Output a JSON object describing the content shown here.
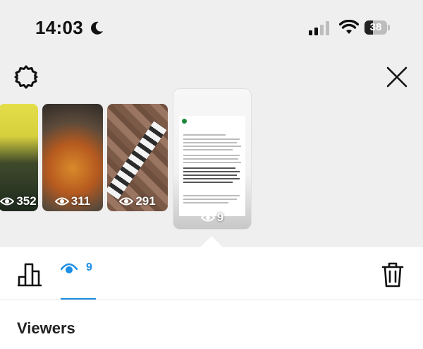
{
  "status_bar": {
    "time": "14:03",
    "battery_level": "38",
    "battery_fraction": 0.38,
    "icons": [
      "moon-icon",
      "signal-icon",
      "wifi-icon",
      "battery-icon"
    ]
  },
  "header": {
    "icons": [
      "settings-icon",
      "close-icon"
    ]
  },
  "stories": [
    {
      "views": "352"
    },
    {
      "views": "311"
    },
    {
      "views": "291"
    },
    {
      "views": "9",
      "selected": true
    }
  ],
  "toolbar": {
    "views_count": "9",
    "icons": [
      "stats-icon",
      "eye-icon",
      "trash-icon"
    ],
    "accent_color": "#1e8fe6"
  },
  "viewers": {
    "heading": "Viewers"
  }
}
